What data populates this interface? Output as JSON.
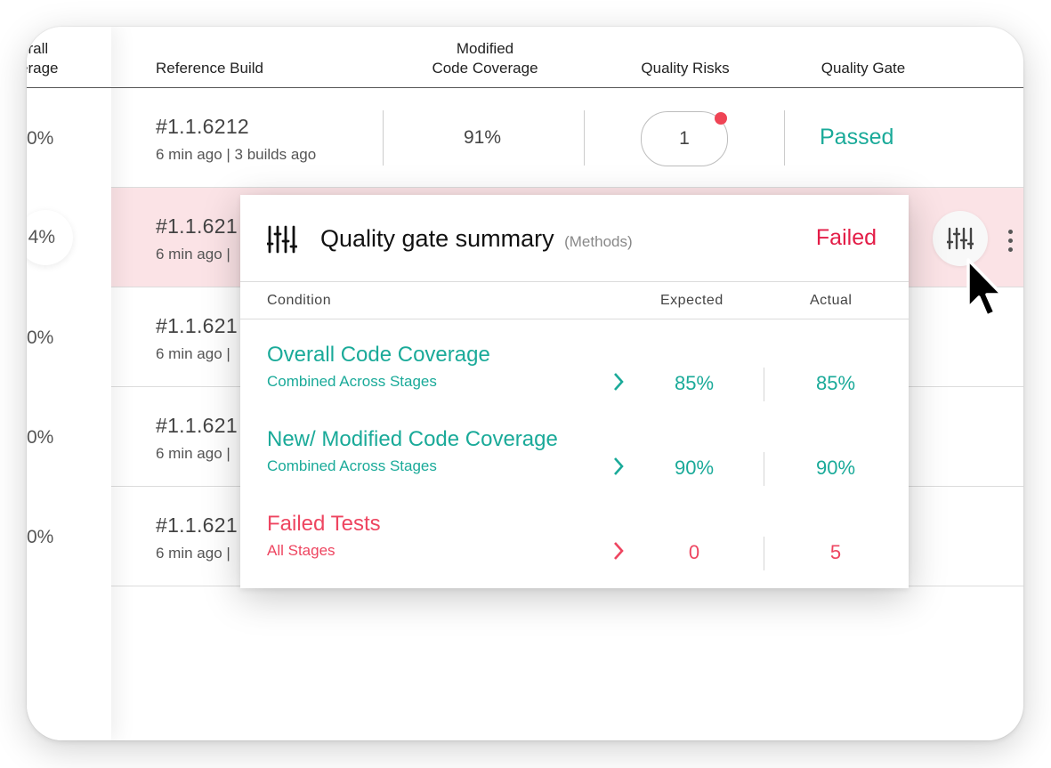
{
  "header": {
    "col_overall_line1": "erall",
    "col_overall_line2": "erage",
    "col_reference_build": "Reference Build",
    "col_modified_line1": "Modified",
    "col_modified_line2": "Code Coverage",
    "col_quality_risks": "Quality Risks",
    "col_quality_gate": "Quality Gate"
  },
  "rows": [
    {
      "overall": "0%",
      "build": "#1.1.6212",
      "sub": "6 min ago | 3 builds ago",
      "modified": "91%",
      "risks": "1",
      "gate": "Passed"
    },
    {
      "overall": "4%",
      "build": "#1.1.621",
      "sub": "6 min ago |"
    },
    {
      "overall": "0%",
      "build": "#1.1.621",
      "sub": "6 min ago |"
    },
    {
      "overall": "0%",
      "build": "#1.1.621",
      "sub": "6 min ago |"
    },
    {
      "overall": "0%",
      "build": "#1.1.621",
      "sub": "6 min ago |"
    }
  ],
  "popup": {
    "title": "Quality gate summary",
    "subtitle": "(Methods)",
    "status": "Failed",
    "col_condition": "Condition",
    "col_expected": "Expected",
    "col_actual": "Actual",
    "conditions": [
      {
        "title": "Overall Code Coverage",
        "sub": "Combined Across Stages",
        "expected": "85%",
        "actual": "85%"
      },
      {
        "title": "New/ Modified Code Coverage",
        "sub": "Combined Across Stages",
        "expected": "90%",
        "actual": "90%"
      },
      {
        "title": "Failed Tests",
        "sub": "All Stages",
        "expected": "0",
        "actual": "5"
      }
    ]
  },
  "colors": {
    "pass": "#1aaa99",
    "fail": "#e31d47",
    "fail_soft": "#ee4560",
    "highlight_row": "#fbe3e6",
    "risk_dot": "#ef4455"
  },
  "icons": [
    "filter-sliders-icon",
    "chevron-right-icon",
    "kebab-menu-icon",
    "mouse-pointer-icon",
    "notification-dot"
  ]
}
